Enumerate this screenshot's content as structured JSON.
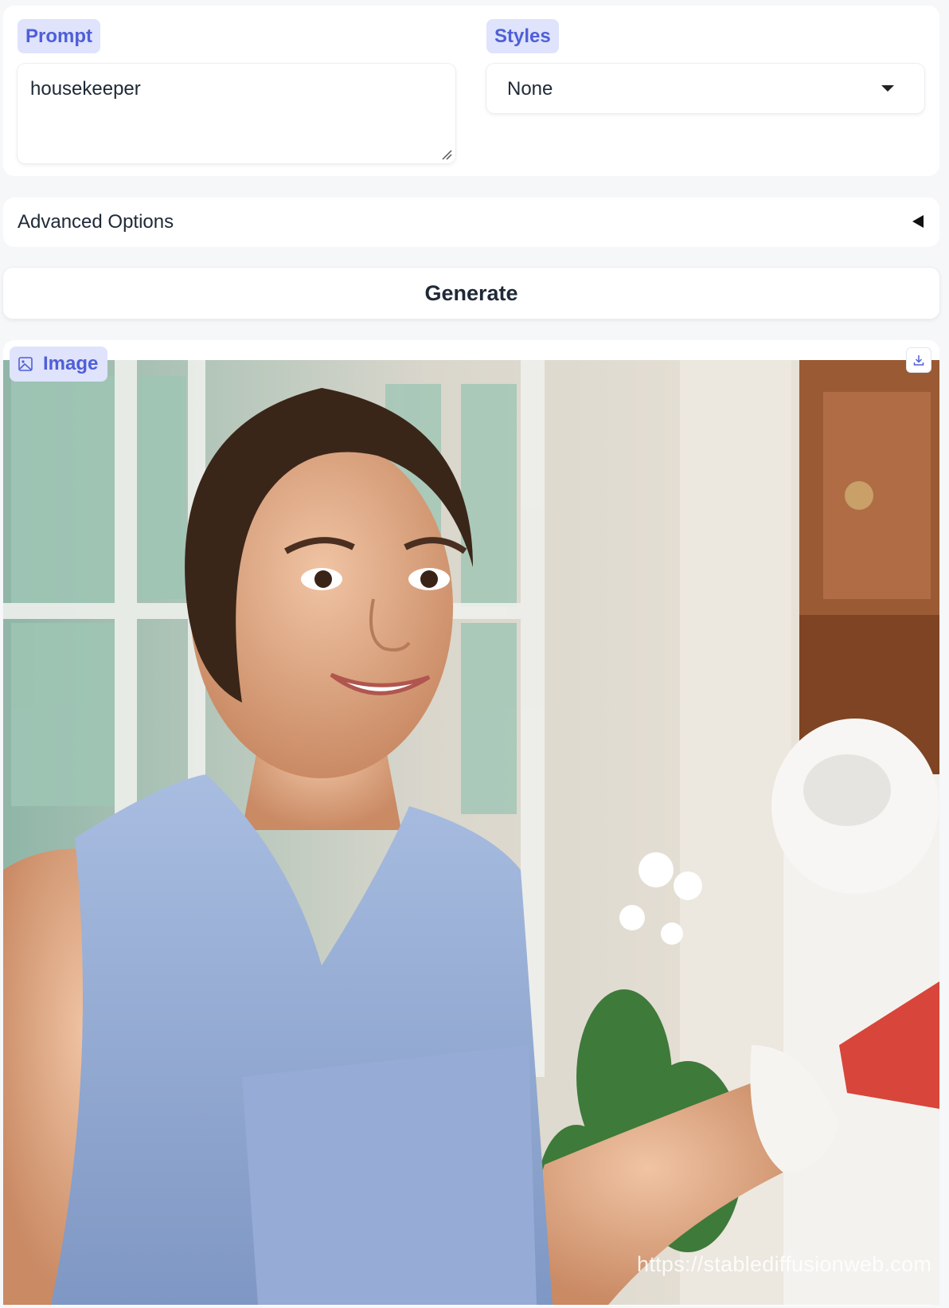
{
  "prompt": {
    "label": "Prompt",
    "value": "housekeeper"
  },
  "styles": {
    "label": "Styles",
    "selected": "None"
  },
  "advanced": {
    "label": "Advanced Options"
  },
  "generate": {
    "label": "Generate"
  },
  "output": {
    "label": "Image",
    "watermark": "https://stablediffusionweb.com",
    "icons": [
      "image-icon",
      "download-icon"
    ]
  },
  "colors": {
    "accent": "#4f5fd8",
    "chip_bg": "#dfe3fb",
    "page_bg": "#f6f7f9"
  }
}
